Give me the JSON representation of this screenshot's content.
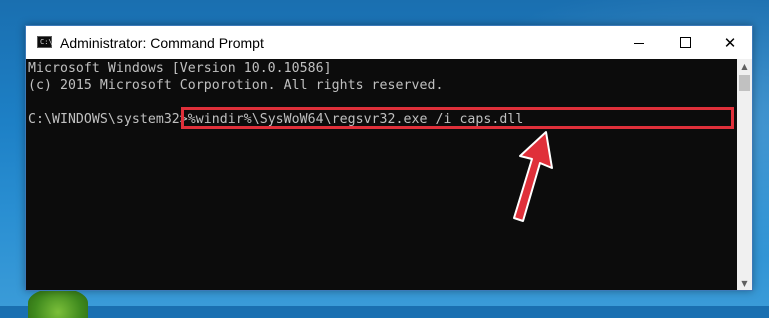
{
  "window": {
    "title": "Administrator: Command Prompt",
    "icon": "cmd-icon",
    "icon_text": "C:\\",
    "controls": {
      "minimize": "minimize-icon",
      "maximize": "maximize-icon",
      "close": "close-icon",
      "close_glyph": "✕"
    }
  },
  "console": {
    "lines": [
      "Microsoft Windows [Version 10.0.10586]",
      "(c) 2015 Microsoft Corporotion. All rights reserved."
    ],
    "prompt": "C:\\WINDOWS\\system32>",
    "command": "%windir%\\SysWoW64\\regsvr32.exe /i caps.dll"
  },
  "scrollbar": {
    "up_glyph": "▲",
    "down_glyph": "▼"
  },
  "colors": {
    "console_bg": "#0c0c0c",
    "console_text": "#c0c0c0",
    "highlight": "#e0303a",
    "arrow": "#e0303a"
  }
}
